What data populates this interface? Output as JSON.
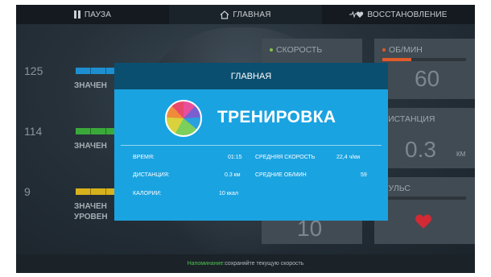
{
  "topbar": {
    "pause": "ПАУЗА",
    "home": "ГЛАВНАЯ",
    "recovery": "ВОССТАНОВЛЕНИЕ"
  },
  "left_metrics": [
    {
      "value": "125",
      "label": "ЗНАЧЕН",
      "color": "#1d8fd1"
    },
    {
      "value": "114",
      "label": "ЗНАЧЕН",
      "color": "#3aa93a"
    },
    {
      "value": "9",
      "label": "ЗНАЧЕН",
      "label2": "УРОВЕН",
      "color": "#d7b21c"
    }
  ],
  "tiles": {
    "speed": {
      "label": "СКОРОСТЬ",
      "color": "#7fc24a"
    },
    "rpm": {
      "label": "ОБ/МИН",
      "value": "60",
      "color": "#e05a2a",
      "level": 0.35
    },
    "distance": {
      "label": "ДИСТАНЦИЯ",
      "value": "0.3",
      "unit": "КМ"
    },
    "pulse": {
      "label": "ПУЛЬС"
    },
    "hidden_value": "10"
  },
  "dialog": {
    "header": "ГЛАВНАЯ",
    "title": "ТРЕНИРОВКА",
    "stats": {
      "time_label": "ВРЕМЯ:",
      "time_value": "01:15",
      "distance_label": "ДИСТАНЦИЯ:",
      "distance_value": "0.3 км",
      "calories_label": "КАЛОРИИ:",
      "calories_value": "10 ккал",
      "avg_speed_label": "СРЕДНЯЯ СКОРОСТЬ",
      "avg_speed_value": "22,4 ч/км",
      "avg_rpm_label": "СРЕДНИЕ ОБ/МИН",
      "avg_rpm_value": "59"
    }
  },
  "reminder": {
    "prefix": "Напоминание:",
    "text": " сохраняйте текущую скорость"
  }
}
